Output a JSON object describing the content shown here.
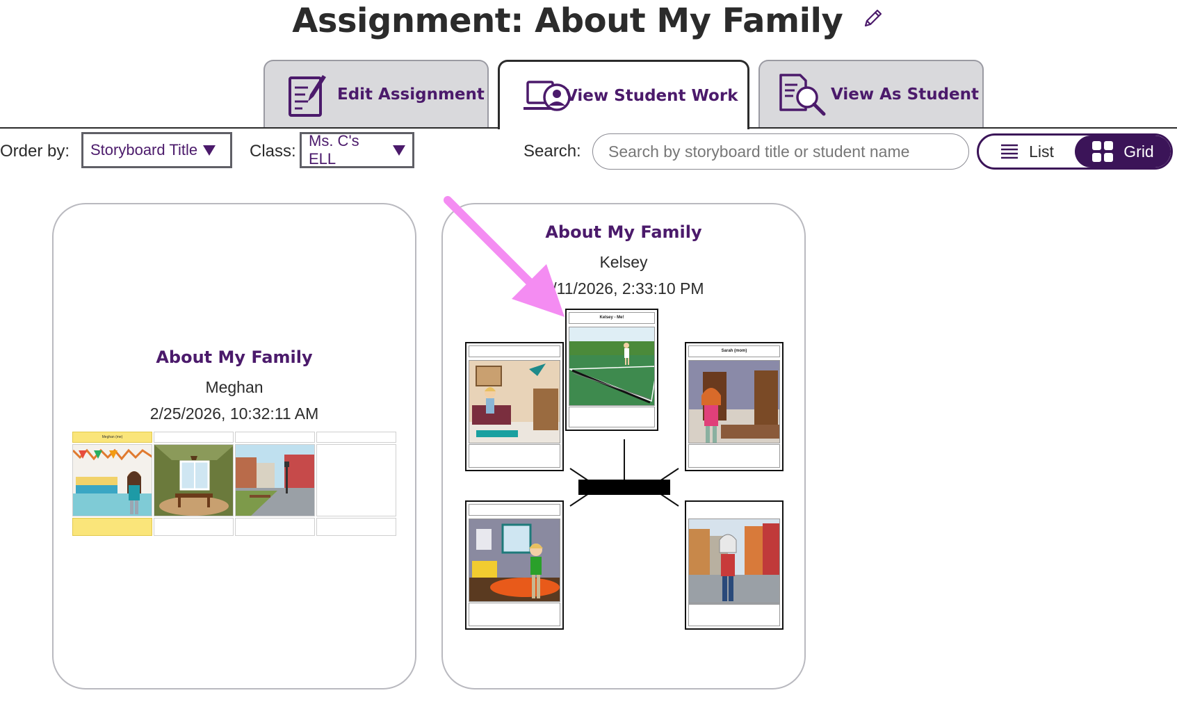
{
  "page": {
    "title": "Assignment: About My Family"
  },
  "tabs": [
    {
      "label": "Edit Assignment",
      "icon": "edit-document-icon",
      "active": false
    },
    {
      "label": "View Student Work",
      "icon": "laptop-student-icon",
      "active": true
    },
    {
      "label": "View As Student",
      "icon": "document-magnifier-icon",
      "active": false
    }
  ],
  "toolbar": {
    "order_label": "Order by:",
    "order_value": "Storyboard Title",
    "class_label": "Class:",
    "class_value": "Ms. C's ELL",
    "search_label": "Search:",
    "search_placeholder": "Search by storyboard title or student name",
    "list_label": "List",
    "grid_label": "Grid",
    "selected_view": "Grid"
  },
  "cards": [
    {
      "title": "About My Family",
      "student": "Meghan",
      "date": "2/25/2026, 10:32:11 AM",
      "thumb_header_1": "Meghan (me)"
    },
    {
      "title": "About My Family",
      "student": "Kelsey",
      "date": "2/11/2026, 2:33:10 PM",
      "frame_center_title": "Kelsey - Me!",
      "frame_right_title": "Sarah (mom)"
    }
  ],
  "colors": {
    "brand_purple": "#4b1a6b",
    "toggle_dark": "#3b1458",
    "annotation_arrow": "#f48cf2"
  }
}
